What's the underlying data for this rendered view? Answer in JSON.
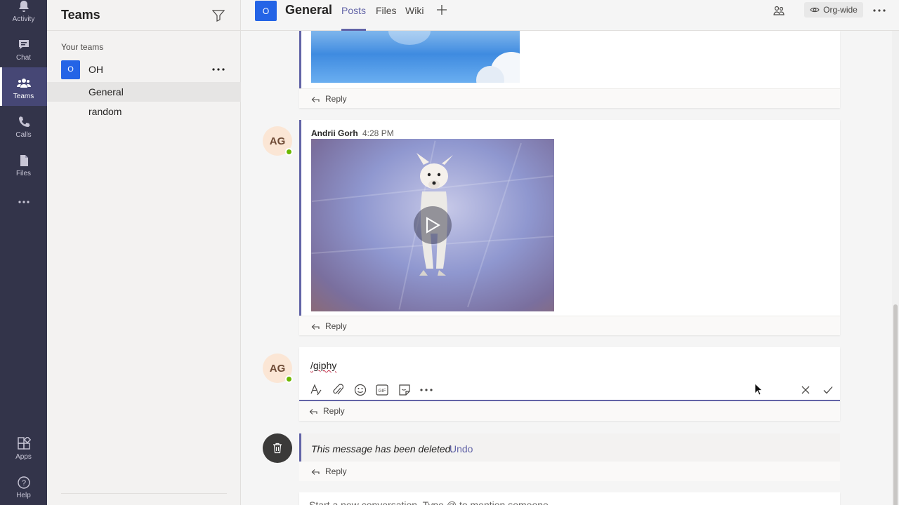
{
  "rail": {
    "items": [
      {
        "label": "Activity",
        "icon": "bell-icon"
      },
      {
        "label": "Chat",
        "icon": "chat-icon"
      },
      {
        "label": "Teams",
        "icon": "teams-icon",
        "active": true
      },
      {
        "label": "Calls",
        "icon": "phone-icon"
      },
      {
        "label": "Files",
        "icon": "file-icon"
      },
      {
        "label": "",
        "icon": "more-icon"
      },
      {
        "label": "Apps",
        "icon": "apps-icon"
      },
      {
        "label": "Help",
        "icon": "help-icon"
      }
    ]
  },
  "panel": {
    "title": "Teams",
    "section_label": "Your teams",
    "team": {
      "avatar": "O",
      "name": "OH"
    },
    "channels": [
      {
        "name": "General",
        "active": true
      },
      {
        "name": "random",
        "active": false
      }
    ]
  },
  "header": {
    "avatar": "O",
    "title": "General",
    "tabs": [
      {
        "label": "Posts",
        "active": true
      },
      {
        "label": "Files",
        "active": false
      },
      {
        "label": "Wiki",
        "active": false
      }
    ],
    "org_wide": "Org-wide",
    "accent": "#6264a7"
  },
  "messages": {
    "first": {
      "reply": "Reply"
    },
    "second": {
      "avatar": "AG",
      "author": "Andrii Gorh",
      "time": "4:28 PM",
      "reply": "Reply"
    },
    "editing": {
      "avatar": "AG",
      "text": "/giphy",
      "reply": "Reply"
    },
    "deleted": {
      "text": "This message has been deleted.",
      "undo": "Undo",
      "reply": "Reply"
    }
  },
  "compose": {
    "placeholder": "Start a new conversation. Type @ to mention someone."
  }
}
